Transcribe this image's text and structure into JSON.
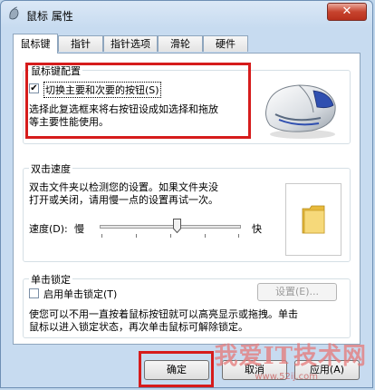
{
  "window": {
    "title": "鼠标 属性",
    "close_label": "✕"
  },
  "tabs": [
    {
      "label": "鼠标键",
      "active": true
    },
    {
      "label": "指针",
      "active": false
    },
    {
      "label": "指针选项",
      "active": false
    },
    {
      "label": "滑轮",
      "active": false
    },
    {
      "label": "硬件",
      "active": false
    }
  ],
  "button_config": {
    "group_title": "鼠标键配置",
    "switch_checkbox_label": "切换主要和次要的按钮(S)",
    "switch_checked": true,
    "description_line1": "选择此复选框来将右按钮设成如选择和拖放",
    "description_line2": "等主要性能使用。"
  },
  "double_click": {
    "group_title": "双击速度",
    "description_line1": "双击文件夹以检测您的设置。如果文件夹没",
    "description_line2": "打开或关闭，请用慢一点的设置再试一次。",
    "speed_label": "速度(D):",
    "slow_label": "慢",
    "fast_label": "快",
    "speed_level": 0.55
  },
  "click_lock": {
    "group_title": "单击锁定",
    "checkbox_label": "启用单击锁定(T)",
    "checked": false,
    "settings_button": "设置(E)...",
    "description_line1": "使您可以不用一直按着鼠标按钮就可以高亮显示或拖拽。单击",
    "description_line2": "鼠标以进入锁定状态，再次单击鼠标可解除锁定。"
  },
  "footer": {
    "ok_label": "确定",
    "cancel_label": "取消",
    "apply_label": "应用(A)"
  },
  "watermark": {
    "text": "我爱IT技术网",
    "url": "www.52ij.com"
  },
  "colors": {
    "highlight_red": "#d61c1c",
    "window_frame": "#c7dbf0",
    "close_button": "#c7432e"
  }
}
